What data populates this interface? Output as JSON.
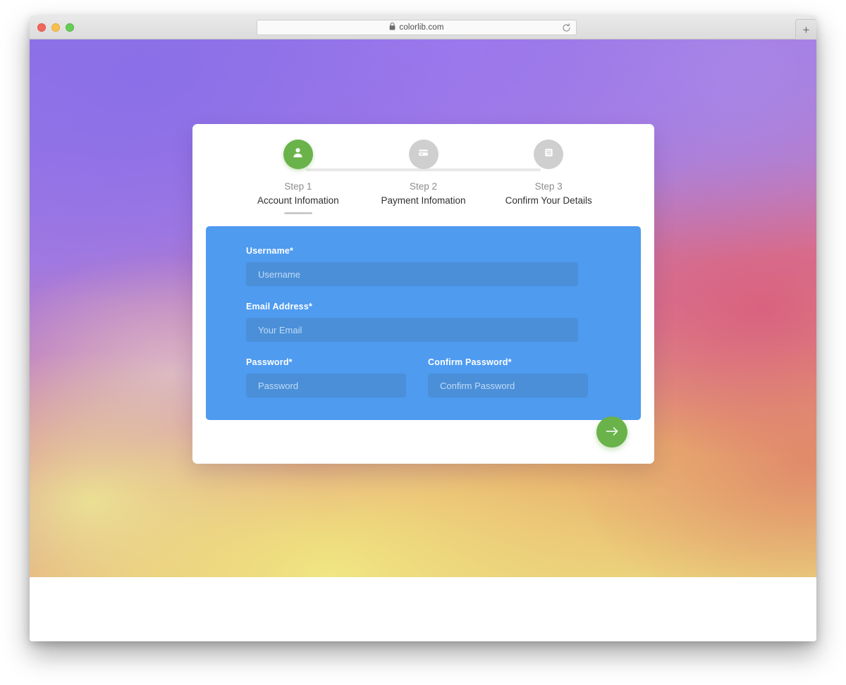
{
  "browser": {
    "url": "colorlib.com",
    "lock_icon": "lock-icon",
    "reload_icon": "reload-icon",
    "new_tab_label": "+",
    "traffic_lights": [
      "close",
      "minimize",
      "zoom"
    ]
  },
  "wizard": {
    "steps": [
      {
        "number": "Step 1",
        "title": "Account Infomation",
        "icon": "user-icon",
        "state": "active",
        "color": "#6ab24a"
      },
      {
        "number": "Step 2",
        "title": "Payment Infomation",
        "icon": "credit-card-icon",
        "state": "inactive",
        "color": "#cfcfcf"
      },
      {
        "number": "Step 3",
        "title": "Confirm Your Details",
        "icon": "document-lines-icon",
        "state": "inactive",
        "color": "#cfcfcf"
      }
    ],
    "form": {
      "panel_color": "#4e9bf0",
      "fields": [
        {
          "label": "Username*",
          "placeholder": "Username",
          "value": ""
        },
        {
          "label": "Email Address*",
          "placeholder": "Your Email",
          "value": ""
        },
        {
          "label": "Password*",
          "placeholder": "Password",
          "value": ""
        },
        {
          "label": "Confirm Password*",
          "placeholder": "Confirm Password",
          "value": ""
        }
      ]
    },
    "next_button": {
      "icon": "arrow-right-icon",
      "color": "#6ab24a"
    }
  }
}
